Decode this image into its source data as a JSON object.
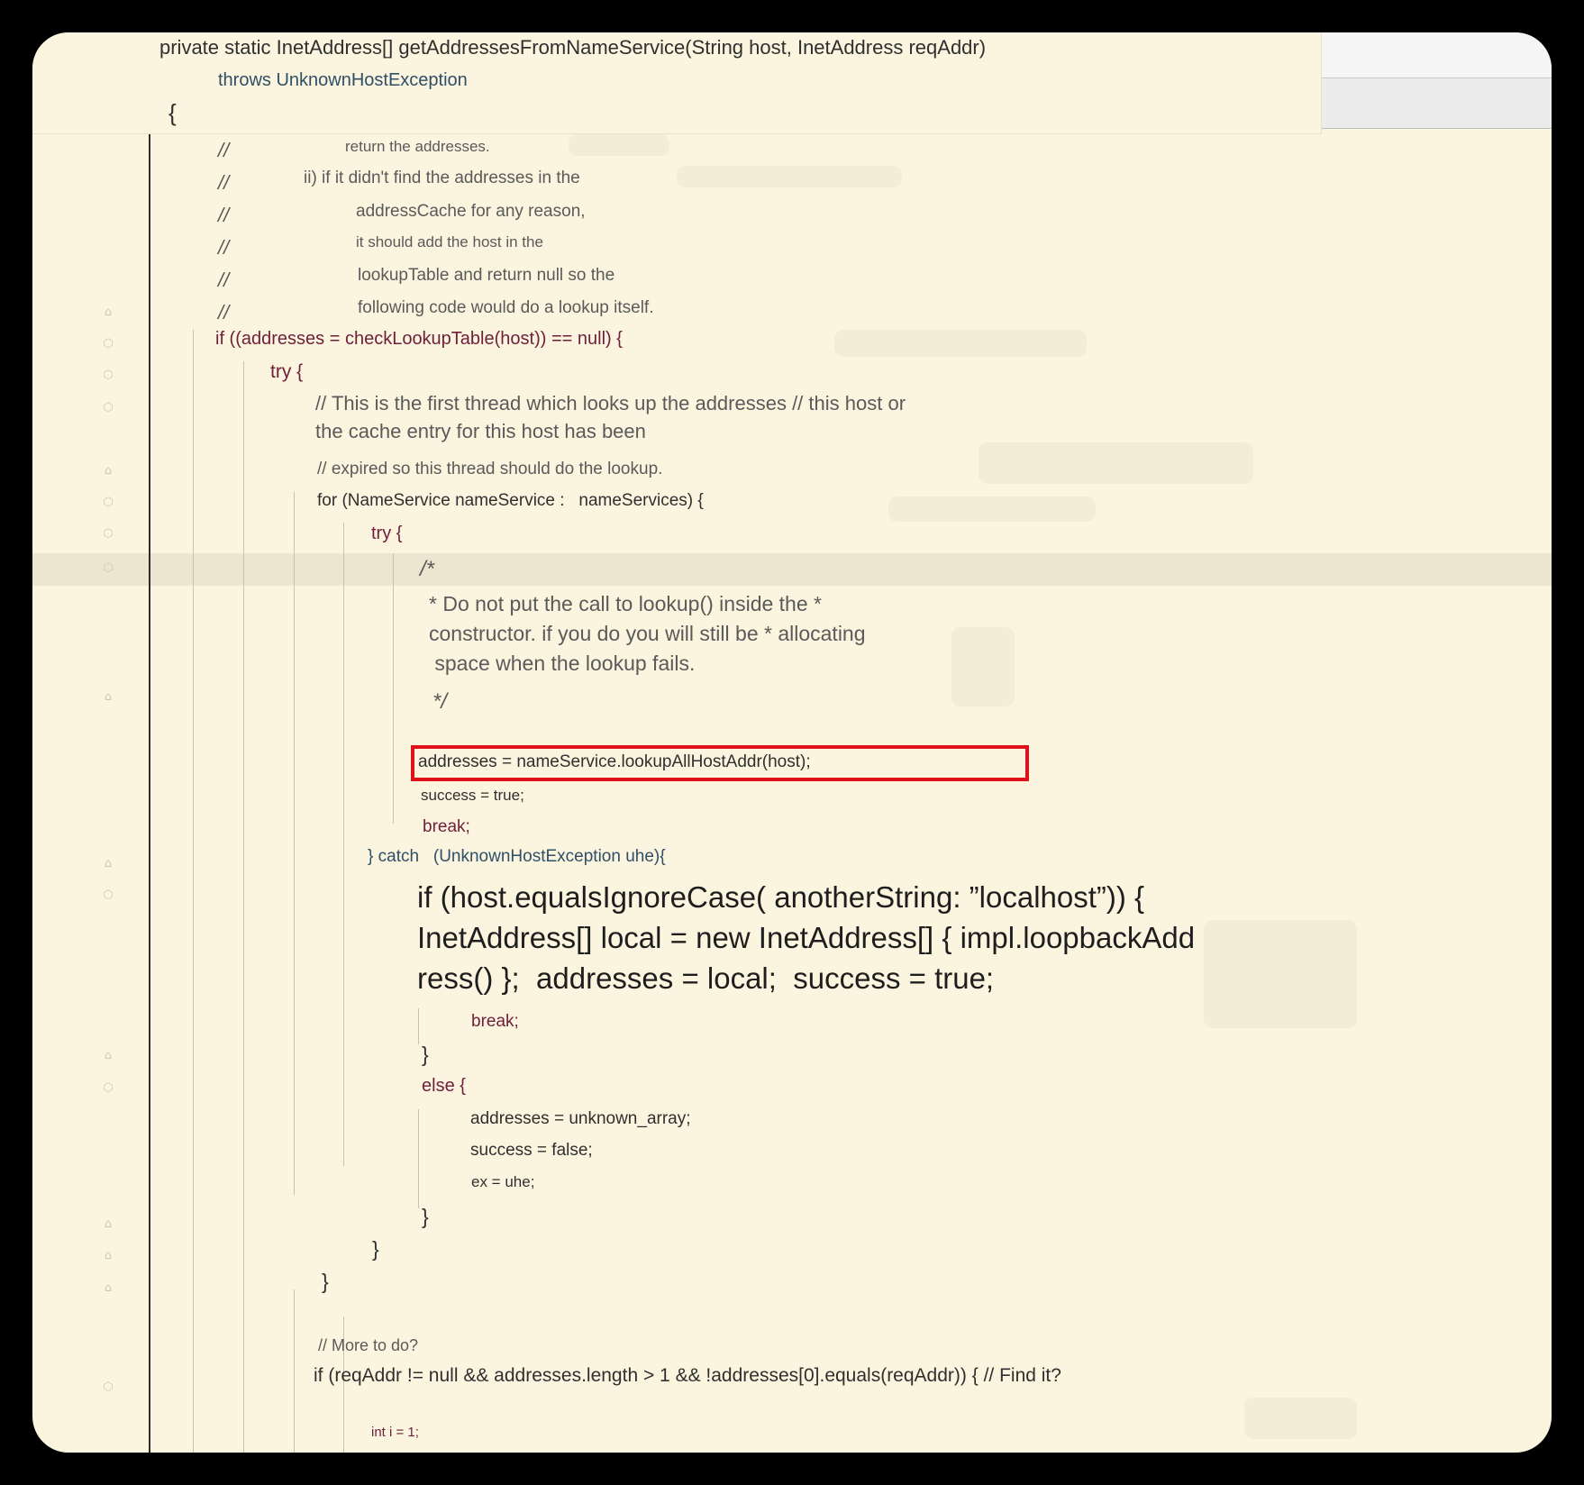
{
  "editor": {
    "header": {
      "signature": "private static InetAddress[] getAddressesFromNameService(String host, InetAddress reqAddr)",
      "throws": "throws UnknownHostException",
      "open_brace": "{"
    },
    "comments_top": [
      {
        "slash": "//",
        "text": "return the addresses."
      },
      {
        "slash": "//",
        "text": "ii) if it didn't find the addresses in the"
      },
      {
        "slash": "//",
        "text": "addressCache for any reason,"
      },
      {
        "slash": "//",
        "text": "it should add the host in the"
      },
      {
        "slash": "//",
        "text": "lookupTable and return null so the"
      },
      {
        "slash": "//",
        "text": "following code would do a lookup itself."
      }
    ],
    "if_lookup": "if ((addresses = checkLookupTable(host)) == null) {",
    "try_outer": "try {",
    "comment_first_thread_1": "// This is the first thread which looks up the addresses // this host or",
    "comment_first_thread_2": "the cache entry for this host has been",
    "comment_expired": "// expired so this thread should do the lookup.",
    "for_loop": "for (NameService nameService :   nameServices) {",
    "try_inner": "try {",
    "block_comment_open": "/*",
    "block_comment_1": "* Do not put the call to lookup() inside the *",
    "block_comment_2": "constructor. if you do you will still be * allocating",
    "block_comment_3": " space when the lookup fails.",
    "block_comment_close": "*/",
    "highlighted_line": "addresses = nameService.lookupAllHostAddr(host);",
    "success_true": "success = true;",
    "break_1": "break;",
    "catch_line": "} catch   (UnknownHostException uhe){",
    "large_line_1": "if (host.equalsIgnoreCase( anotherString: ”localhost”)) {",
    "large_line_2": "InetAddress[] local = new InetAddress[] { impl.loopbackAdd",
    "large_line_3": "ress() };  addresses = local;  success = true;",
    "break_2": "break;",
    "close_if": "}",
    "else_line": "else {",
    "addresses_unknown": "addresses = unknown_array;",
    "success_false": "success = false;",
    "ex_uhe": "ex = uhe;",
    "close_else": "}",
    "close_catch": "}",
    "close_for": "}",
    "comment_more": "// More to do?",
    "if_reqaddr": "if (reqAddr != null && addresses.length > 1 && !addresses[0].equals(reqAddr)) { // Find it?",
    "int_i": "int i = 1;"
  },
  "icons": {
    "fold_marker": "fold-marker-icon"
  },
  "colors": {
    "editor_background": "#fbf5df",
    "keyword": "#6e1f3a",
    "highlight_box": "#e0101a",
    "current_line": "#ece6d1"
  }
}
